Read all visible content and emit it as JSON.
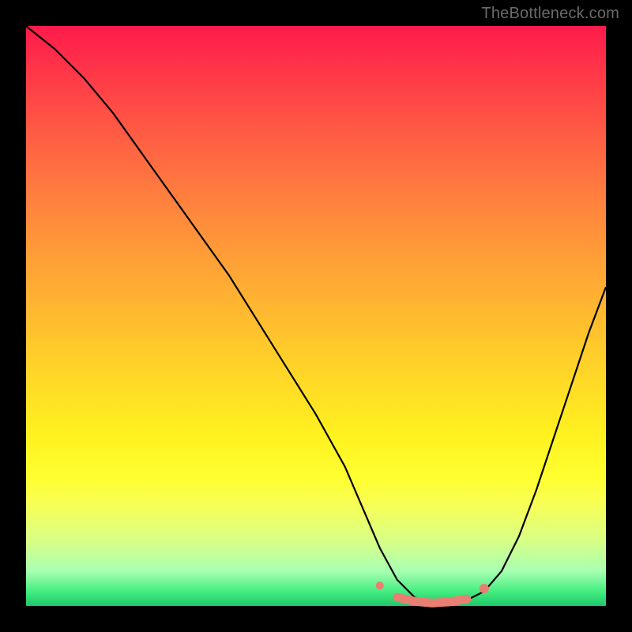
{
  "watermark": "TheBottleneck.com",
  "colors": {
    "background": "#000000",
    "curve": "#000000",
    "accent": "#e97f73",
    "gradient_top": "#ff1a4a",
    "gradient_bottom": "#1fc76a"
  },
  "chart_data": {
    "type": "line",
    "title": "",
    "xlabel": "",
    "ylabel": "",
    "xlim": [
      0,
      100
    ],
    "ylim": [
      0,
      100
    ],
    "series": [
      {
        "name": "bottleneck-curve",
        "x": [
          0,
          5,
          10,
          15,
          20,
          25,
          30,
          35,
          40,
          45,
          50,
          55,
          58,
          61,
          64,
          67,
          70,
          73,
          76,
          79,
          82,
          85,
          88,
          91,
          94,
          97,
          100
        ],
        "values": [
          100,
          96,
          91,
          85,
          78,
          71,
          64,
          57,
          49,
          41,
          33,
          24,
          17,
          10,
          4.5,
          1.5,
          0.5,
          0.5,
          1,
          2.5,
          6,
          12,
          20,
          29,
          38,
          47,
          55
        ]
      },
      {
        "name": "optimal-range-marker",
        "x": [
          61,
          64,
          67,
          70,
          73,
          76,
          79
        ],
        "values": [
          3.5,
          1.5,
          0.8,
          0.5,
          0.7,
          1.2,
          3.0
        ]
      }
    ],
    "annotations": []
  }
}
